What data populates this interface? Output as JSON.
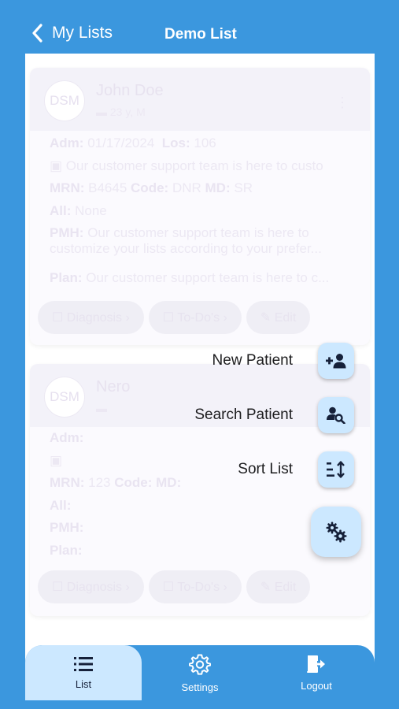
{
  "header": {
    "back_label": "My Lists",
    "title": "Demo List"
  },
  "cards": [
    {
      "initials": "DSM",
      "name": "John Doe",
      "sub": "▬ 23 y, M",
      "adm_label": "Adm:",
      "adm_value": "01/17/2024",
      "los_label": "Los:",
      "los_value": "106",
      "note": "Our customer support team is here to custo",
      "mrn_label": "MRN:",
      "mrn_value": "B4645",
      "code_label": "Code:",
      "code_value": "DNR",
      "md_label": "MD:",
      "md_value": "SR",
      "all_label": "All:",
      "all_value": "None",
      "pmh_label": "PMH:",
      "pmh_value": "Our customer support team is here to customize your lists according to your prefer...",
      "plan_label": "Plan:",
      "plan_value": "Our customer support team is here to c...",
      "chips": [
        "☐ Diagnosis ›",
        "☐ To-Do's ›",
        "✎ Edit"
      ]
    },
    {
      "initials": "DSM",
      "name": "Nero",
      "sub": "▬",
      "adm_label": "Adm:",
      "adm_value": "",
      "los_label": "",
      "los_value": "",
      "note": "",
      "mrn_label": "MRN:",
      "mrn_value": "123",
      "code_label": "Code:",
      "code_value": "",
      "md_label": "MD:",
      "md_value": "",
      "all_label": "All:",
      "all_value": "",
      "pmh_label": "PMH:",
      "pmh_value": "",
      "plan_label": "Plan:",
      "plan_value": "",
      "chips": [
        "☐ Diagnosis ›",
        "☐ To-Do's ›",
        "✎ Edit"
      ]
    }
  ],
  "fab_menu": {
    "new_patient": "New Patient",
    "search_patient": "Search Patient",
    "sort_list": "Sort List",
    "main_icon": "gears-icon"
  },
  "tabs": [
    {
      "label": "List",
      "icon": "list-icon",
      "active": true
    },
    {
      "label": "Settings",
      "icon": "gear-icon",
      "active": false
    },
    {
      "label": "Logout",
      "icon": "logout-icon",
      "active": false
    }
  ],
  "colors": {
    "brand": "#3b97de",
    "fab_bg": "#cce8ff",
    "icon_dark": "#16213a"
  }
}
